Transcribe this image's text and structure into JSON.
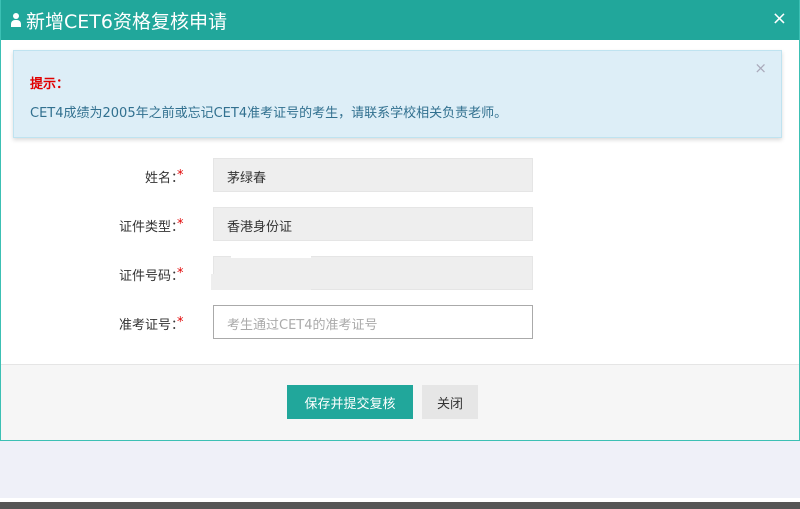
{
  "dialog": {
    "title": "新增CET6资格复核申请",
    "close_label": "×"
  },
  "alert": {
    "title": "提示：",
    "message": "CET4成绩为2005年之前或忘记CET4准考证号的考生，请联系学校相关负责老师。",
    "close_label": "×"
  },
  "form": {
    "required_mark": "*",
    "fields": [
      {
        "label": "姓名：",
        "value": "茅绿春"
      },
      {
        "label": "证件类型：",
        "value": "香港身份证"
      },
      {
        "label": "证件号码：",
        "value": ""
      },
      {
        "label": "准考证号：",
        "value": "",
        "placeholder": "考生通过CET4的准考证号"
      }
    ]
  },
  "footer": {
    "save_label": "保存并提交复核",
    "close_label": "关闭"
  },
  "colors": {
    "accent": "#21a79b",
    "required": "#e10000",
    "alert_bg": "#ddeef7"
  }
}
